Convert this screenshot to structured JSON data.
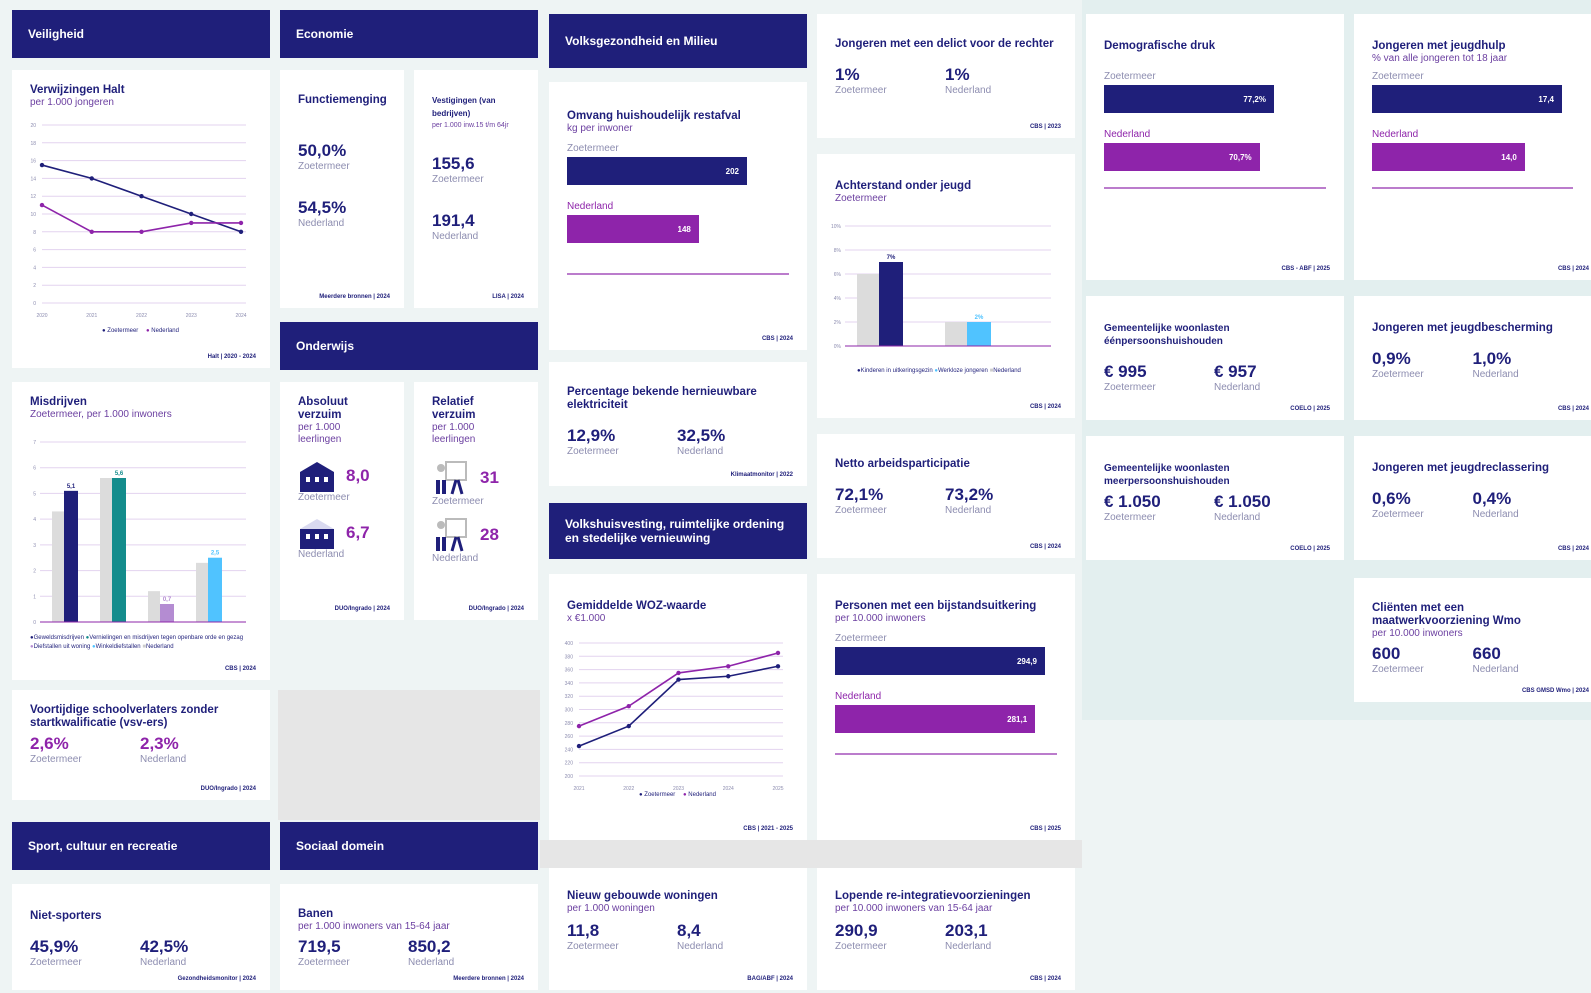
{
  "sections": {
    "veiligheid": "Veiligheid",
    "economie": "Economie",
    "onderwijs": "Onderwijs",
    "volksgezondheid": "Volksgezondheid en Milieu",
    "volkshuisvesting": "Volkshuisvesting, ruimtelijke ordening en stedelijke vernieuwing",
    "sport": "Sport, cultuur en recreatie",
    "sociaal": "Sociaal domein"
  },
  "labels": {
    "zoetermeer": "Zoetermeer",
    "nederland": "Nederland"
  },
  "halt": {
    "title": "Verwijzingen Halt",
    "subtitle": "per 1.000 jongeren",
    "source": "Halt | 2020 - 2024",
    "legend": [
      "Zoetermeer",
      "Nederland"
    ]
  },
  "misdrijven": {
    "title": "Misdrijven",
    "subtitle": "Zoetermeer, per 1.000 inwoners",
    "source": "CBS | 2024",
    "legend": [
      "Geweldsmisdrijven",
      "Vernielingen en misdrijven tegen openbare orde en gezag",
      "Diefstallen uit woning",
      "Winkeldiefstallen",
      "Nederland"
    ]
  },
  "vsv": {
    "title": "Voortijdige schoolverlaters zonder startkwalificatie (vsv-ers)",
    "z": "2,6%",
    "n": "2,3%",
    "source": "DUO/Ingrado | 2024"
  },
  "functiemenging": {
    "title": "Functiemenging",
    "z": "50,0%",
    "n": "54,5%",
    "source": "Meerdere bronnen | 2024"
  },
  "vestigingen": {
    "title": "Vestigingen (van bedrijven)",
    "subtitle": "per 1.000 inw.15 t/m 64jr",
    "z": "155,6",
    "n": "191,4",
    "source": "LISA | 2024"
  },
  "absoluut": {
    "title": "Absoluut verzuim",
    "subtitle": "per 1.000 leerlingen",
    "z": "8,0",
    "n": "6,7",
    "source": "DUO/Ingrado | 2024"
  },
  "relatief": {
    "title": "Relatief verzuim",
    "subtitle": "per 1.000 leerlingen",
    "z": "31",
    "n": "28",
    "source": "DUO/Ingrado | 2024"
  },
  "restafval": {
    "title": "Omvang huishoudelijk restafval",
    "subtitle": "kg per inwoner",
    "z": "202",
    "n": "148",
    "source": "CBS | 2024"
  },
  "elektriciteit": {
    "title": "Percentage bekende hernieuwbare elektriciteit",
    "z": "12,9%",
    "n": "32,5%",
    "source": "Klimaatmonitor | 2022"
  },
  "woz": {
    "title": "Gemiddelde WOZ-waarde",
    "subtitle": "x €1.000",
    "source": "CBS | 2021 - 2025",
    "legend": [
      "Zoetermeer",
      "Nederland"
    ]
  },
  "woningen": {
    "title": "Nieuw gebouwde woningen",
    "subtitle": "per 1.000 woningen",
    "z": "11,8",
    "n": "8,4",
    "source": "BAG/ABF | 2024"
  },
  "delict": {
    "title": "Jongeren met een delict voor de rechter",
    "z": "1%",
    "n": "1%",
    "source": "CBS | 2023"
  },
  "achterstand": {
    "title": "Achterstand onder jeugd",
    "subtitle": "Zoetermeer",
    "source": "CBS | 2024",
    "legend": [
      "Kinderen in uitkeringsgezin",
      "Werkloze jongeren",
      "Nederland"
    ]
  },
  "arbeid": {
    "title": "Netto arbeidsparticipatie",
    "z": "72,1%",
    "n": "73,2%",
    "source": "CBS | 2024"
  },
  "bijstand": {
    "title": "Personen met een bijstandsuitkering",
    "subtitle": "per 10.000 inwoners",
    "z": "294,9",
    "n": "281,1",
    "source": "CBS | 2025"
  },
  "reintegratie": {
    "title": "Lopende re-integratievoorzieningen",
    "subtitle": "per 10.000 inwoners van 15-64 jaar",
    "z": "290,9",
    "n": "203,1",
    "source": "CBS | 2024"
  },
  "demografisch": {
    "title": "Demografische druk",
    "z": "77,2%",
    "n": "70,7%",
    "source": "CBS - ABF | 2025"
  },
  "jeugdhulp": {
    "title": "Jongeren met jeugdhulp",
    "subtitle": "% van alle jongeren tot 18 jaar",
    "z": "17,4",
    "n": "14,0",
    "source": "CBS | 2024"
  },
  "woonlasten1": {
    "title": "Gemeentelijke woonlasten éénpersoonshuishouden",
    "z": "€ 995",
    "n": "€ 957",
    "source": "COELO | 2025"
  },
  "jeugdbescherming": {
    "title": "Jongeren met jeugdbescherming",
    "z": "0,9%",
    "n": "1,0%",
    "source": "CBS | 2024"
  },
  "woonlasten2": {
    "title": "Gemeentelijke woonlasten meerpersoonshuishouden",
    "z": "€ 1.050",
    "n": "€ 1.050",
    "source": "COELO | 2025"
  },
  "jeugdreclassering": {
    "title": "Jongeren met jeugdreclassering",
    "z": "0,6%",
    "n": "0,4%",
    "source": "CBS | 2024"
  },
  "wmo": {
    "title": "Cliënten met een maatwerkvoorziening Wmo",
    "subtitle": "per 10.000 inwoners",
    "z": "600",
    "n": "660",
    "source": "CBS GMSD Wmo | 2024"
  },
  "nietsporters": {
    "title": "Niet-sporters",
    "z": "45,9%",
    "n": "42,5%",
    "source": "Gezondheidsmonitor | 2024"
  },
  "banen": {
    "title": "Banen",
    "subtitle": "per 1.000 inwoners van 15-64 jaar",
    "z": "719,5",
    "n": "850,2",
    "source": "Meerdere bronnen | 2024"
  },
  "chart_data": [
    {
      "id": "halt",
      "type": "line",
      "x": [
        2020,
        2021,
        2022,
        2023,
        2024
      ],
      "series": [
        {
          "name": "Zoetermeer",
          "values": [
            15.5,
            14,
            12,
            10,
            8
          ]
        },
        {
          "name": "Nederland",
          "values": [
            11,
            8,
            8,
            9,
            9
          ]
        }
      ],
      "ylim": [
        0,
        20
      ],
      "yticks": [
        0,
        2,
        4,
        6,
        8,
        10,
        12,
        14,
        16,
        18,
        20
      ]
    },
    {
      "id": "misdrijven",
      "type": "bar",
      "series": [
        {
          "name": "Geweldsmisdrijven",
          "value": 5.1,
          "label": "5,1",
          "nl": 4.3,
          "color": "#1f1f7a"
        },
        {
          "name": "Vernielingen en misdrijven tegen openbare orde en gezag",
          "value": 5.6,
          "label": "5,6",
          "nl": 5.6,
          "color": "#148c8c"
        },
        {
          "name": "Diefstallen uit woning",
          "value": 0.7,
          "label": "0,7",
          "nl": 1.2,
          "color": "#b48cd2"
        },
        {
          "name": "Winkeldiefstallen",
          "value": 2.5,
          "label": "2,5",
          "nl": 2.3,
          "color": "#50c3ff"
        }
      ],
      "ylim": [
        0,
        7
      ],
      "yticks": [
        0,
        1,
        2,
        3,
        4,
        5,
        6,
        7
      ]
    },
    {
      "id": "woz",
      "type": "line",
      "x": [
        2021,
        2022,
        2023,
        2024,
        2025
      ],
      "series": [
        {
          "name": "Zoetermeer",
          "values": [
            245,
            275,
            345,
            350,
            365
          ]
        },
        {
          "name": "Nederland",
          "values": [
            275,
            305,
            355,
            365,
            385
          ]
        }
      ],
      "ylim": [
        200,
        400
      ],
      "yticks": [
        200,
        220,
        240,
        260,
        280,
        300,
        320,
        340,
        360,
        380,
        400
      ]
    },
    {
      "id": "achterstand",
      "type": "bar",
      "series": [
        {
          "name": "Kinderen in uitkeringsgezin",
          "value": 7,
          "label": "7%",
          "nl": 6,
          "color": "#1f1f7a"
        },
        {
          "name": "Werkloze jongeren",
          "value": 2,
          "label": "2%",
          "nl": 2,
          "color": "#50c3ff"
        }
      ],
      "ylim": [
        0,
        10
      ],
      "yticks": [
        0,
        2,
        4,
        6,
        8,
        10
      ]
    },
    {
      "id": "restafval",
      "type": "bar",
      "categories": [
        "Zoetermeer",
        "Nederland"
      ],
      "values": [
        202,
        148
      ]
    },
    {
      "id": "bijstand",
      "type": "bar",
      "categories": [
        "Zoetermeer",
        "Nederland"
      ],
      "values": [
        294.9,
        281.1
      ]
    },
    {
      "id": "demografisch",
      "type": "bar",
      "categories": [
        "Zoetermeer",
        "Nederland"
      ],
      "values": [
        77.2,
        70.7
      ]
    },
    {
      "id": "jeugdhulp",
      "type": "bar",
      "categories": [
        "Zoetermeer",
        "Nederland"
      ],
      "values": [
        17.4,
        14.0
      ]
    }
  ]
}
